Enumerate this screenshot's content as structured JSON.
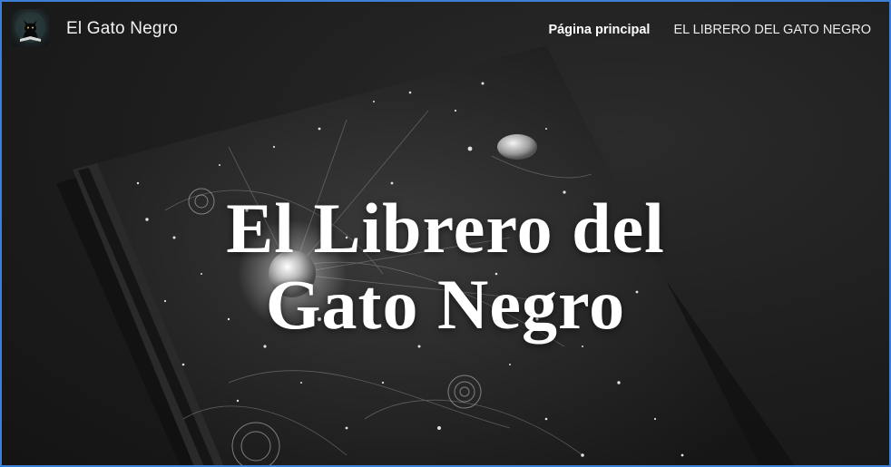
{
  "header": {
    "site_name": "El Gato Negro",
    "logo_icon": "black-cat-logo-icon",
    "nav": [
      {
        "label": "Página principal",
        "active": true
      },
      {
        "label": "EL LIBRERO DEL GATO NEGRO",
        "active": false
      }
    ]
  },
  "hero": {
    "title_line1": "El Librero del",
    "title_line2": "Gato Negro",
    "image_icon": "cosmic-book-cover-image"
  },
  "colors": {
    "frame_border": "#3d7fd6",
    "background": "#1d1d1d",
    "text": "#ffffff"
  }
}
